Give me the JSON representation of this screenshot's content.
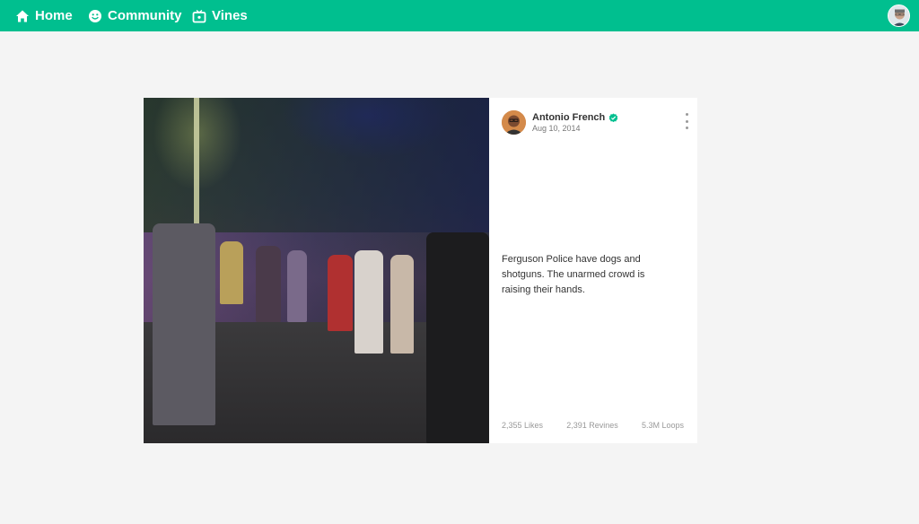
{
  "nav": {
    "home": "Home",
    "community": "Community",
    "vines": "Vines"
  },
  "post": {
    "author": "Antonio French",
    "date": "Aug 10, 2014",
    "caption": "Ferguson Police have dogs and shotguns. The unarmed crowd is raising their hands.",
    "likes": "2,355 Likes",
    "revines": "2,391 Revines",
    "loops": "5.3M Loops"
  },
  "colors": {
    "brand": "#00bf8f",
    "background": "#f4f4f4"
  }
}
